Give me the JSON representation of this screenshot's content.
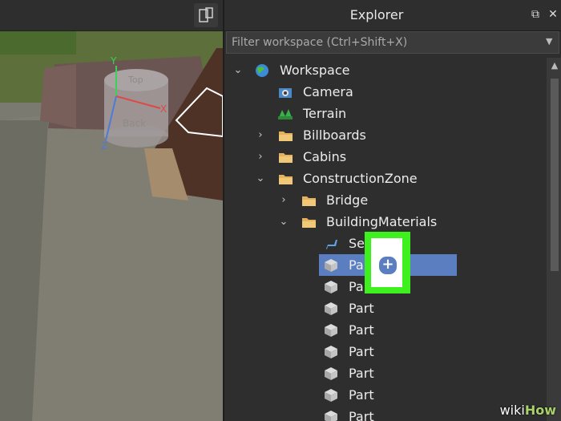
{
  "explorer": {
    "title": "Explorer",
    "filter_placeholder": "Filter workspace (Ctrl+Shift+X)"
  },
  "tree": [
    {
      "label": "Workspace",
      "icon": "globe-icon",
      "expand": "open"
    },
    {
      "label": "Camera",
      "icon": "camera-icon",
      "expand": "none"
    },
    {
      "label": "Terrain",
      "icon": "terrain-icon",
      "expand": "none"
    },
    {
      "label": "Billboards",
      "icon": "folder-icon",
      "expand": "closed"
    },
    {
      "label": "Cabins",
      "icon": "folder-icon",
      "expand": "closed"
    },
    {
      "label": "ConstructionZone",
      "icon": "folder-icon",
      "expand": "open"
    },
    {
      "label": "Bridge",
      "icon": "folder-icon",
      "expand": "closed"
    },
    {
      "label": "BuildingMaterials",
      "icon": "folder-icon",
      "expand": "open"
    },
    {
      "label": "Seat",
      "icon": "seat-icon",
      "expand": "none"
    },
    {
      "label": "Part",
      "icon": "part-icon",
      "expand": "none",
      "selected": true
    },
    {
      "label": "Part",
      "icon": "part-icon",
      "expand": "none"
    },
    {
      "label": "Part",
      "icon": "part-icon",
      "expand": "none"
    },
    {
      "label": "Part",
      "icon": "part-icon",
      "expand": "none"
    },
    {
      "label": "Part",
      "icon": "part-icon",
      "expand": "none"
    },
    {
      "label": "Part",
      "icon": "part-icon",
      "expand": "none"
    },
    {
      "label": "Part",
      "icon": "part-icon",
      "expand": "none"
    },
    {
      "label": "Part",
      "icon": "part-icon",
      "expand": "none"
    }
  ],
  "viewport": {
    "part_face_labels": [
      "Top",
      "Back"
    ],
    "axis_labels": [
      "Y",
      "X",
      "Z"
    ]
  },
  "watermark": {
    "wiki": "wiki",
    "how": "How"
  },
  "colors": {
    "selection": "#5b7ec0",
    "highlight": "#3ef11e",
    "panel_bg": "#2e2e2e"
  }
}
